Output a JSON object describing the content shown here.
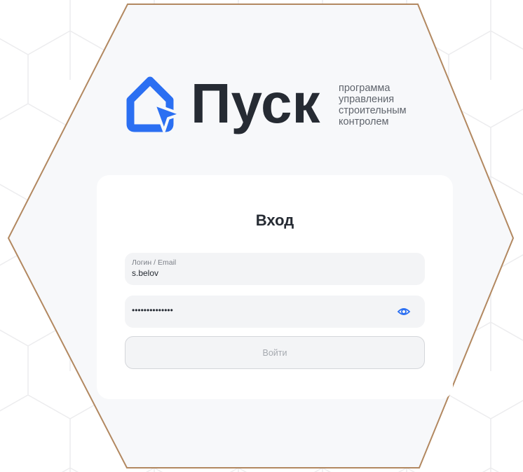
{
  "brand": {
    "name": "Пуск",
    "tagline": [
      "программа",
      "управления",
      "строительным",
      "контролем"
    ],
    "accent_color": "#2b6ff2",
    "text_color": "#262b33"
  },
  "login_form": {
    "title": "Вход",
    "login": {
      "label": "Логин / Email",
      "value": "s.belov"
    },
    "password": {
      "value": "••••••••••••••",
      "toggle_icon": "eye-icon"
    },
    "submit_label": "Войти"
  },
  "colors": {
    "frame_border": "#b28860",
    "hexagon_fill": "#f7f8fa",
    "pattern_line": "#ececee"
  }
}
